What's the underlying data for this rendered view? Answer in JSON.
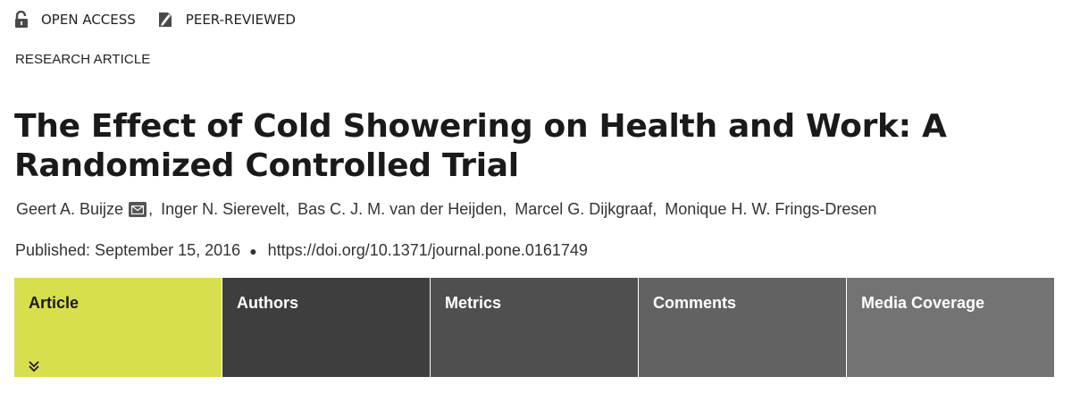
{
  "badges": {
    "open_access": "OPEN ACCESS",
    "peer_reviewed": "PEER-REVIEWED"
  },
  "article_type": "RESEARCH ARTICLE",
  "title": "The Effect of Cold Showering on Health and Work: A Randomized Controlled Trial",
  "authors": [
    "Geert A. Buijze",
    "Inger N. Sierevelt,",
    "Bas C. J. M. van der Heijden,",
    "Marcel G. Dijkgraaf,",
    "Monique H. W. Frings-Dresen"
  ],
  "published": "Published: September 15, 2016",
  "doi": "https://doi.org/10.1371/journal.pone.0161749",
  "tabs": [
    {
      "label": "Article",
      "active": true
    },
    {
      "label": "Authors"
    },
    {
      "label": "Metrics"
    },
    {
      "label": "Comments"
    },
    {
      "label": "Media Coverage"
    }
  ],
  "colors": {
    "active_tab": "#d8df4d",
    "tab_dark": "#3e3e3e"
  }
}
